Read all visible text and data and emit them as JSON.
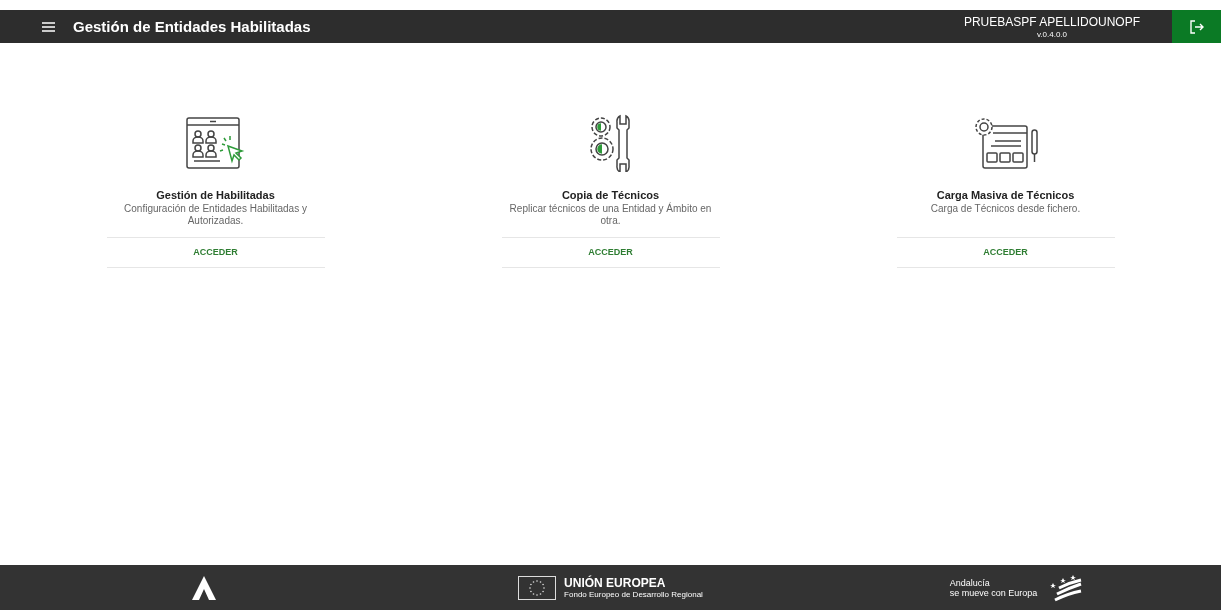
{
  "header": {
    "title": "Gestión de Entidades Habilitadas",
    "user": "PRUEBASPF APELLIDOUNOPF",
    "version": "v.0.4.0.0"
  },
  "cards": [
    {
      "kind": "users",
      "title": "Gestión de Habilitadas",
      "description": "Configuración de Entidades Habilitadas y Autorizadas.",
      "action": "ACCEDER"
    },
    {
      "kind": "tools",
      "title": "Copia de Técnicos",
      "description": "Replicar técnicos de una Entidad y Ámbito en otra.",
      "action": "ACCEDER"
    },
    {
      "kind": "upload",
      "title": "Carga Masiva de Técnicos",
      "description": "Carga de Técnicos desde fichero.",
      "action": "ACCEDER"
    }
  ],
  "footer": {
    "eu_title": "UNIÓN EUROPEA",
    "eu_subtitle": "Fondo Europeo de Desarrollo Regional",
    "region": "Andalucía",
    "region_motto": "se mueve con Europa"
  }
}
